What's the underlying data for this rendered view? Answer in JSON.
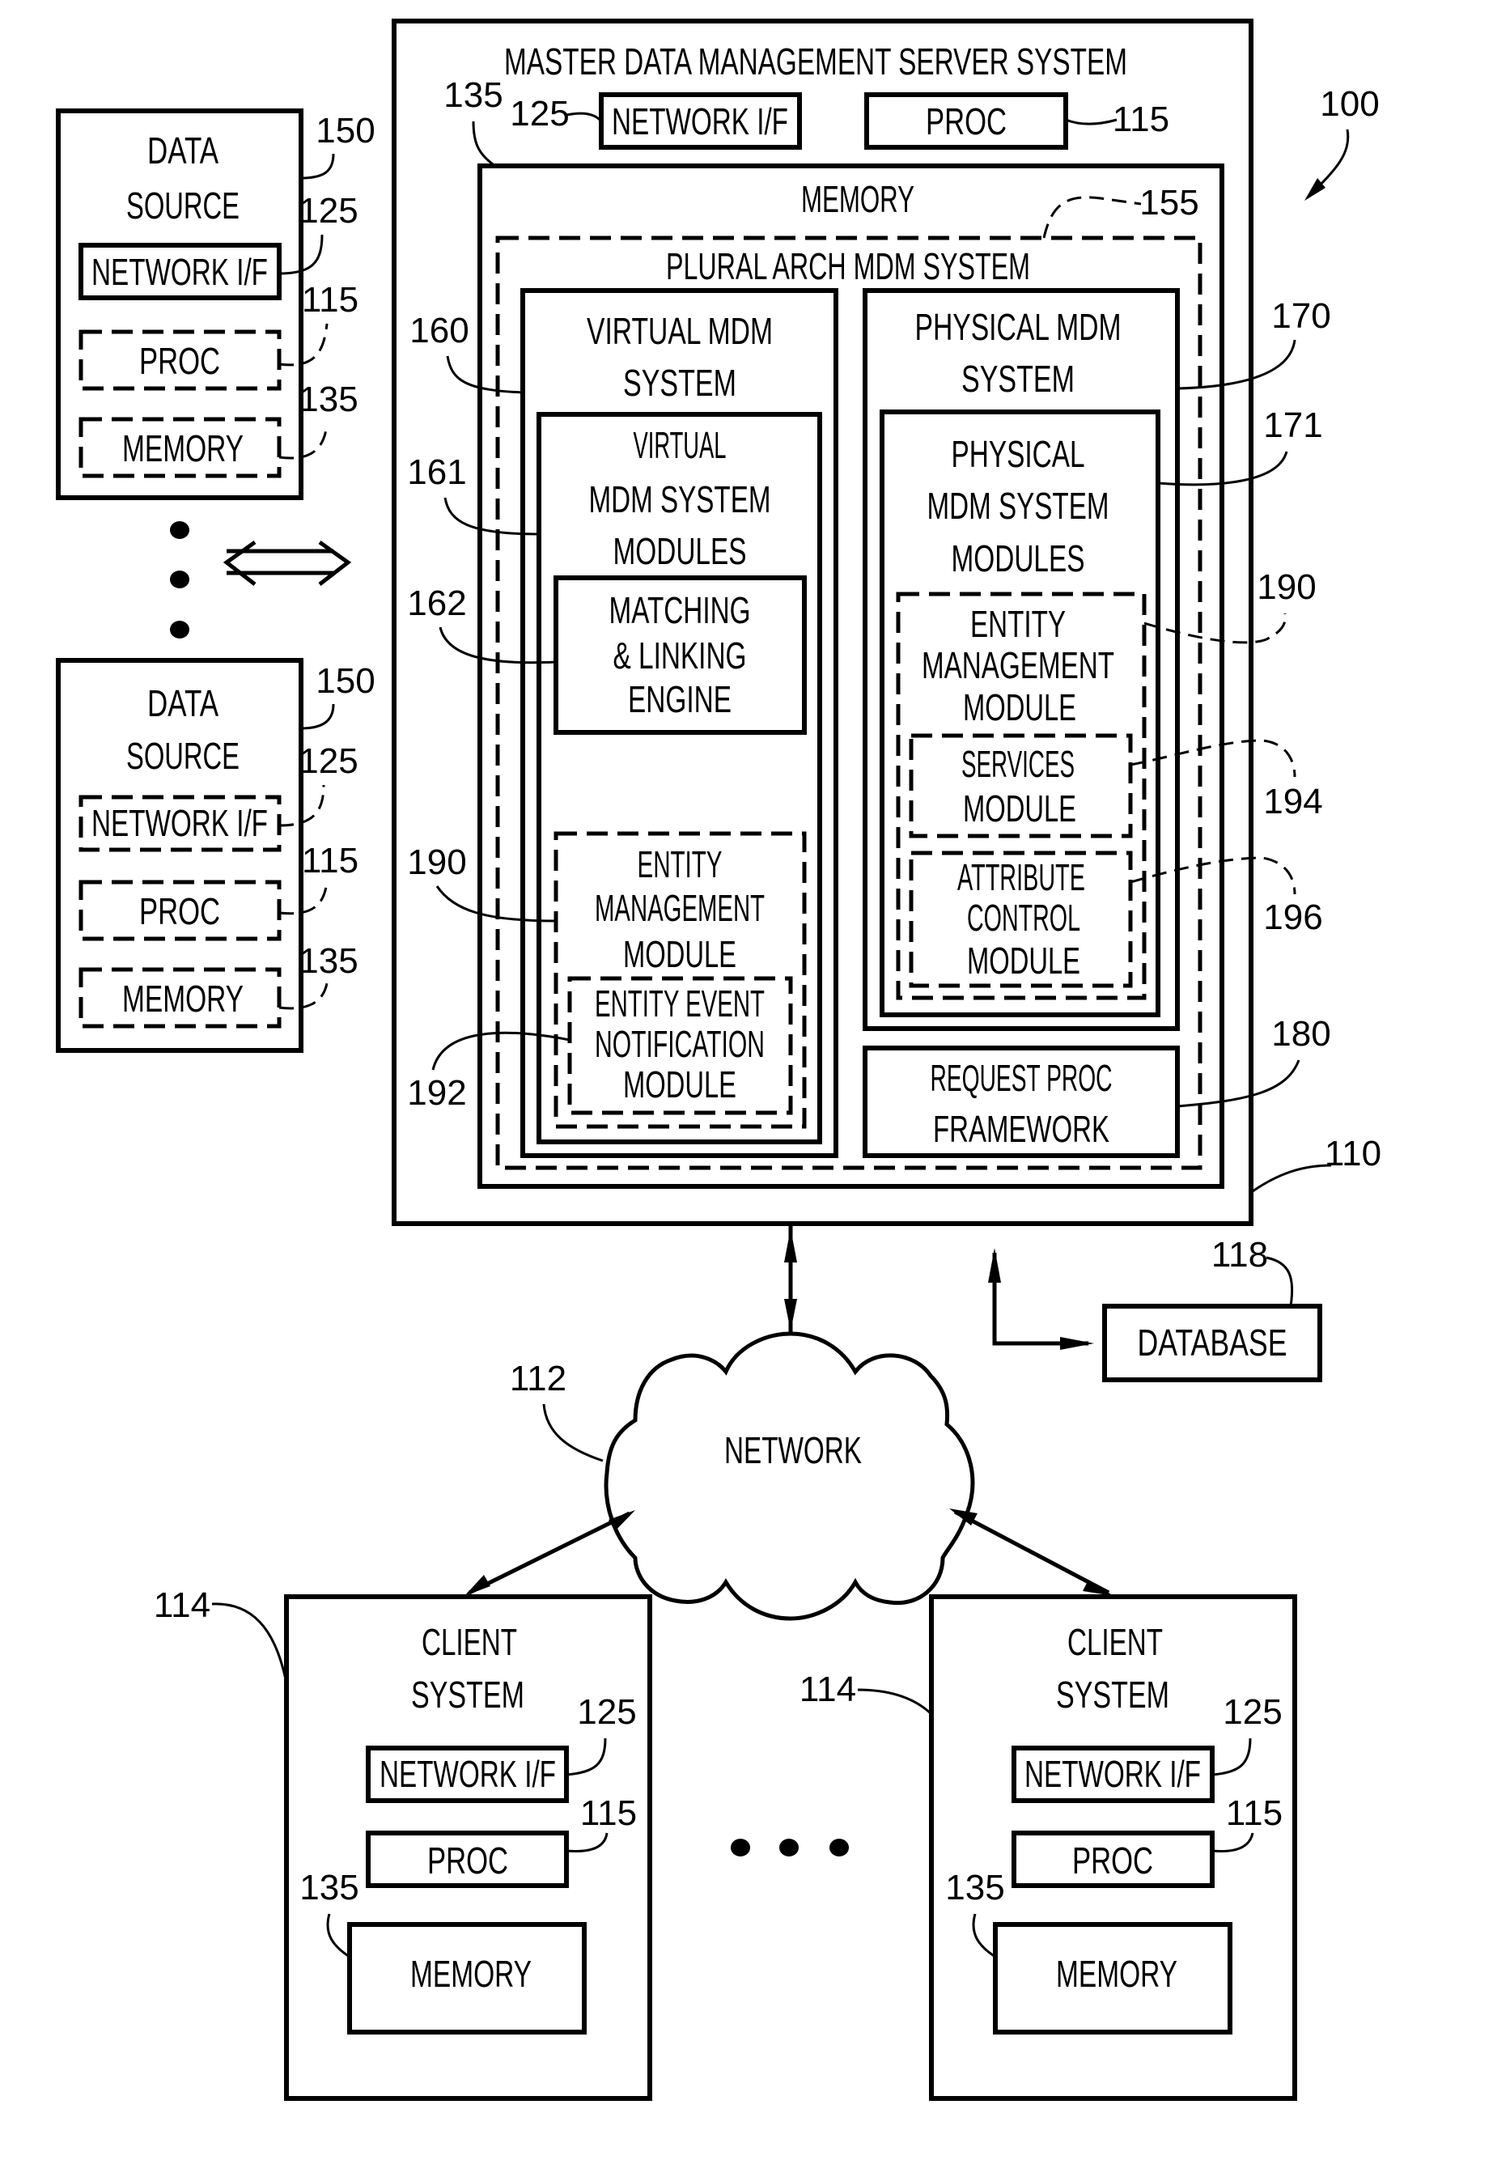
{
  "figure_ref": "100",
  "server": {
    "title": "MASTER DATA MANAGEMENT SERVER SYSTEM",
    "ref": "110",
    "network_if": {
      "label": "NETWORK I/F",
      "ref": "125"
    },
    "proc": {
      "label": "PROC",
      "ref": "115"
    },
    "memory": {
      "label": "MEMORY",
      "ref": "135",
      "plural_arch": {
        "label": "PLURAL ARCH MDM SYSTEM",
        "ref": "155",
        "virtual": {
          "lines": [
            "VIRTUAL MDM",
            "SYSTEM"
          ],
          "ref": "160",
          "modules": {
            "lines": [
              "VIRTUAL",
              "MDM SYSTEM",
              "MODULES"
            ],
            "ref": "161",
            "matching": {
              "lines": [
                "MATCHING",
                "& LINKING",
                "ENGINE"
              ],
              "ref": "162"
            },
            "entity_mgmt": {
              "lines": [
                "ENTITY",
                "MANAGEMENT",
                "MODULE"
              ],
              "ref": "190",
              "event_notification": {
                "lines": [
                  "ENTITY EVENT",
                  "NOTIFICATION",
                  "MODULE"
                ],
                "ref": "192"
              }
            }
          }
        },
        "physical": {
          "lines": [
            "PHYSICAL MDM",
            "SYSTEM"
          ],
          "ref": "170",
          "modules": {
            "lines": [
              "PHYSICAL",
              "MDM SYSTEM",
              "MODULES"
            ],
            "ref": "171",
            "entity_mgmt": {
              "lines": [
                "ENTITY",
                "MANAGEMENT",
                "MODULE"
              ],
              "ref": "190",
              "services": {
                "lines": [
                  "SERVICES",
                  "MODULE"
                ],
                "ref": "194"
              },
              "attribute_control": {
                "lines": [
                  "ATTRIBUTE",
                  "CONTROL",
                  "MODULE"
                ],
                "ref": "196"
              }
            }
          }
        },
        "request_proc": {
          "lines": [
            "REQUEST PROC",
            "FRAMEWORK"
          ],
          "ref": "180"
        }
      }
    }
  },
  "data_sources": [
    {
      "lines": [
        "DATA",
        "SOURCE"
      ],
      "ref": "150",
      "network_if": {
        "label": "NETWORK I/F",
        "ref": "125",
        "style": "solid"
      },
      "proc": {
        "label": "PROC",
        "ref": "115",
        "style": "dashed"
      },
      "memory": {
        "label": "MEMORY",
        "ref": "135",
        "style": "dashed"
      }
    },
    {
      "lines": [
        "DATA",
        "SOURCE"
      ],
      "ref": "150",
      "network_if": {
        "label": "NETWORK I/F",
        "ref": "125",
        "style": "dashed"
      },
      "proc": {
        "label": "PROC",
        "ref": "115",
        "style": "dashed"
      },
      "memory": {
        "label": "MEMORY",
        "ref": "135",
        "style": "dashed"
      }
    }
  ],
  "database": {
    "label": "DATABASE",
    "ref": "118"
  },
  "network": {
    "label": "NETWORK",
    "ref": "112"
  },
  "clients": [
    {
      "lines": [
        "CLIENT",
        "SYSTEM"
      ],
      "ref": "114",
      "network_if": {
        "label": "NETWORK I/F",
        "ref": "125"
      },
      "proc": {
        "label": "PROC",
        "ref": "115"
      },
      "memory": {
        "label": "MEMORY",
        "ref": "135"
      }
    },
    {
      "lines": [
        "CLIENT",
        "SYSTEM"
      ],
      "ref": "114",
      "network_if": {
        "label": "NETWORK I/F",
        "ref": "125"
      },
      "proc": {
        "label": "PROC",
        "ref": "115"
      },
      "memory": {
        "label": "MEMORY",
        "ref": "135"
      }
    }
  ]
}
